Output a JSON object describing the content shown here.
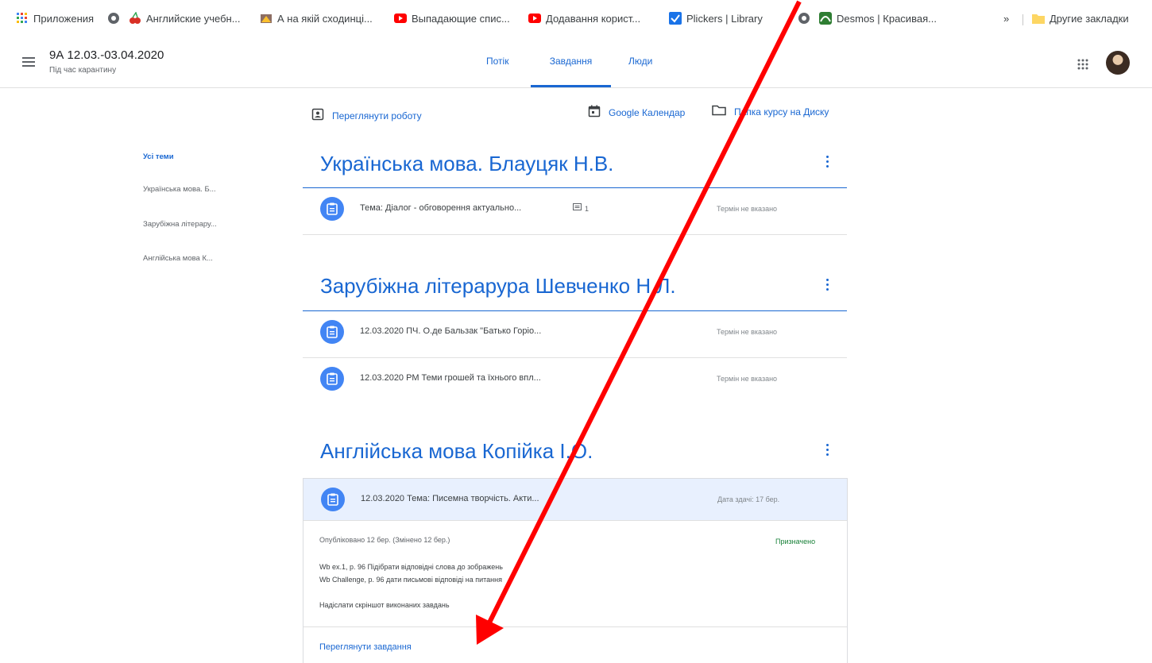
{
  "bookmarks": {
    "items": [
      {
        "label": "Приложения",
        "icon": "apps-grid-icon"
      },
      {
        "label": "",
        "icon": "globe-icon"
      },
      {
        "label": "Английские учебн...",
        "icon": "cherry-icon"
      },
      {
        "label": "А на якій сходинці...",
        "icon": "site-icon"
      },
      {
        "label": "Выпадающие спис...",
        "icon": "youtube-icon"
      },
      {
        "label": "Додавання корист...",
        "icon": "youtube-icon"
      },
      {
        "label": "Plickers | Library",
        "icon": "checkbox-icon"
      },
      {
        "label": "",
        "icon": "globe-icon"
      },
      {
        "label": "Desmos | Красивая...",
        "icon": "desmos-icon"
      }
    ],
    "more": "»",
    "other_bookmarks": "Другие закладки"
  },
  "header": {
    "class_name": "9А 12.03.-03.04.2020",
    "class_subtitle": "Під час карантину",
    "tabs": [
      {
        "label": "Потік",
        "active": false
      },
      {
        "label": "Завдання",
        "active": true
      },
      {
        "label": "Люди",
        "active": false
      }
    ]
  },
  "toolbar": {
    "view_work": "Переглянути роботу",
    "calendar": "Google Календар",
    "drive_folder": "Папка курсу на Диску"
  },
  "sidebar": {
    "topics": [
      {
        "label": "Усі теми",
        "active": true
      },
      {
        "label": "Українська мова. Б...",
        "active": false
      },
      {
        "label": "Зарубіжна літерару...",
        "active": false
      },
      {
        "label": "Англійська мова К...",
        "active": false
      }
    ]
  },
  "sections": [
    {
      "title": "Українська мова. Блауцяк Н.В.",
      "assignments": [
        {
          "title": "Тема: Діалог - обговорення актуально...",
          "comments": "1",
          "due": "Термін не вказано"
        }
      ]
    },
    {
      "title": "Зарубіжна літерарура Шевченко Н.Л.",
      "assignments": [
        {
          "title": "12.03.2020 ПЧ. О.де Бальзак \"Батько Горіо...",
          "due": "Термін не вказано"
        },
        {
          "title": "12.03.2020 РМ Теми грошей та їхнього впл...",
          "due": "Термін не вказано"
        }
      ]
    },
    {
      "title": "Англійська мова Копійка І.О.",
      "expanded_assignment": {
        "title": "12.03.2020 Тема: Писемна творчість. Акти...",
        "due": "Дата здачі: 17 бер.",
        "published": "Опубліковано 12 бер. (Змінено 12 бер.)",
        "status": "Призначено",
        "description": [
          "Wb ex.1, p. 96 Підібрати відповідні слова до зображень",
          "Wb Challenge, p. 96 дати письмові відповіді на питання",
          "Надіслати скріншот виконаних завдань"
        ],
        "view_link": "Переглянути завдання"
      }
    }
  ],
  "colors": {
    "accent": "#1967d2",
    "assignment_icon": "#4285f4",
    "expanded_bg": "#e8f0fe",
    "assigned_status": "#188038",
    "annotation": "#ff0000"
  }
}
